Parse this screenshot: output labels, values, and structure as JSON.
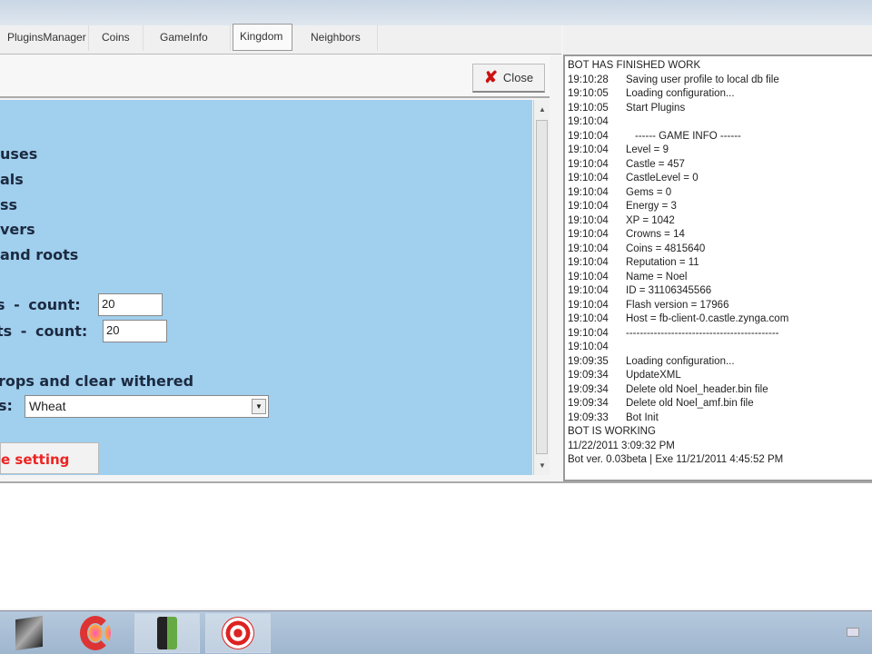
{
  "tabs": [
    "PluginsManager",
    "Coins",
    "GameInfo",
    "Kingdom",
    "Neighbors"
  ],
  "active_tab": "Kingdom",
  "close_label": "Close",
  "options": [
    "uses",
    "als",
    "ss",
    "vers",
    "and roots"
  ],
  "count_rows": [
    {
      "label": "s  -  count:",
      "value": "20"
    },
    {
      "label": "ts  -  count:",
      "value": "20"
    }
  ],
  "crops_label": "rops and clear withered",
  "seed_label": "s:",
  "seed_value": "Wheat",
  "save_label": "e setting",
  "log": [
    [
      "",
      "BOT HAS FINISHED WORK"
    ],
    [
      "19:10:28",
      "Saving user profile to local db file"
    ],
    [
      "19:10:05",
      "Loading configuration..."
    ],
    [
      "19:10:05",
      "Start Plugins"
    ],
    [
      "19:10:04",
      ""
    ],
    [
      "19:10:04",
      "------ GAME INFO ------"
    ],
    [
      "19:10:04",
      "Level = 9"
    ],
    [
      "19:10:04",
      "Castle = 457"
    ],
    [
      "19:10:04",
      "CastleLevel = 0"
    ],
    [
      "19:10:04",
      "Gems = 0"
    ],
    [
      "19:10:04",
      "Energy = 3"
    ],
    [
      "19:10:04",
      "XP = 1042"
    ],
    [
      "19:10:04",
      "Crowns = 14"
    ],
    [
      "19:10:04",
      "Coins = 4815640"
    ],
    [
      "19:10:04",
      "Reputation = 11"
    ],
    [
      "19:10:04",
      "Name = Noel"
    ],
    [
      "19:10:04",
      "ID = 31106345566"
    ],
    [
      "19:10:04",
      "Flash version = 17966"
    ],
    [
      "19:10:04",
      "Host = fb-client-0.castle.zynga.com"
    ],
    [
      "19:10:04",
      "--------------------------------------------"
    ],
    [
      "19:10:04",
      ""
    ],
    [
      "19:09:35",
      "Loading configuration..."
    ],
    [
      "19:09:34",
      "UpdateXML"
    ],
    [
      "19:09:34",
      "Delete old Noel_header.bin file"
    ],
    [
      "19:09:34",
      "Delete old Noel_amf.bin file"
    ],
    [
      "19:09:33",
      "Bot Init"
    ],
    [
      "",
      "BOT IS WORKING"
    ],
    [
      "",
      "11/22/2011 3:09:32 PM"
    ],
    [
      "",
      "Bot ver. 0.03beta | Exe 11/21/2011 4:45:52 PM"
    ]
  ]
}
